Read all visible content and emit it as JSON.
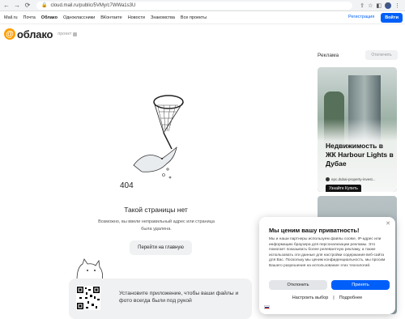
{
  "browser": {
    "url": "cloud.mail.ru/public/5VMy/c7WWa1s3U",
    "avatar_letter": "K"
  },
  "portal": {
    "links": [
      "Mail.ru",
      "Почта",
      "Облако",
      "Одноклассники",
      "ВКонтакте",
      "Новости",
      "Знакомства",
      "Все проекты"
    ],
    "register": "Регистрация",
    "login": "Войти"
  },
  "header": {
    "logo_text": "облако",
    "sub_label": "проект"
  },
  "error": {
    "code": "404",
    "title": "Такой страницы нет",
    "desc": "Возможно, вы ввели неправильный адрес или страница была удалена.",
    "home_button": "Перейти на главную"
  },
  "promo": {
    "text": "Установите приложение, чтобы ваши файлы и фото всегда были под рукой"
  },
  "sidebar": {
    "ad_label": "Реклама",
    "ad_off": "Отключить",
    "ad_title": "Недвижимость в ЖК Harbour Lights в Дубае",
    "ad_source": "epc.dubai-property-invest...",
    "ad_button": "Узнайте Купить"
  },
  "privacy": {
    "title": "Мы ценим вашу приватность!",
    "text": "Мы и наши партнеры используем файлы cookie, IP-адрес или информацию браузера для персонализации рекламы. Это помогает показывать более релевантную рекламу, а также использовать эти данные для настройки содержания веб-сайта для Вас. Поскольку мы ценим конфиденциальность, мы просим Вашего разрешения на использование этих технологий.",
    "reject": "Отклонить",
    "accept": "Принять",
    "link_settings": "Настроить выбор",
    "link_more": "Подробнее"
  },
  "colors": {
    "accent": "#005ff9",
    "logo": "#ff9e00"
  }
}
